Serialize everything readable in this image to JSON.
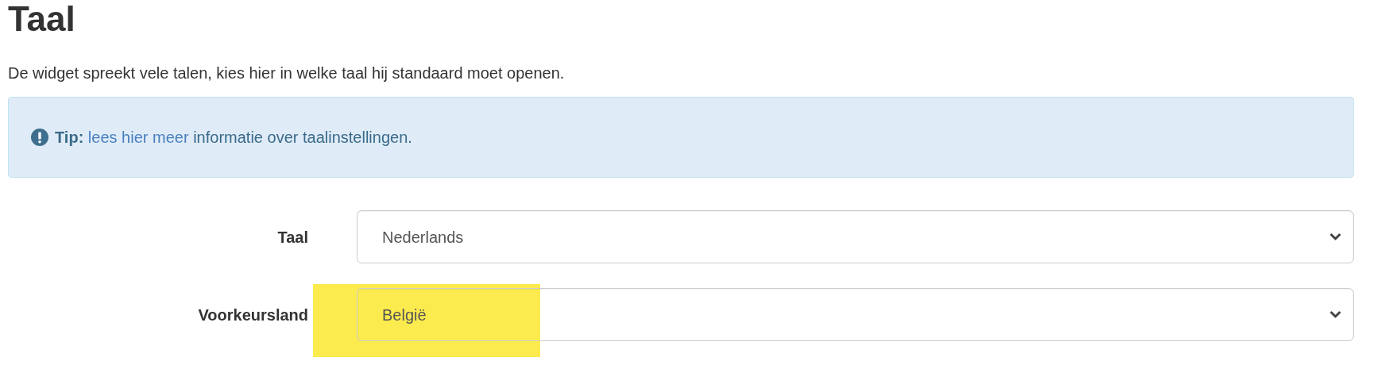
{
  "heading": "Taal",
  "description": "De widget spreekt vele talen, kies hier in welke taal hij standaard moet openen.",
  "alert": {
    "label": "Tip:",
    "link": "lees hier meer",
    "text": "informatie over taalinstellingen."
  },
  "fields": [
    {
      "label": "Taal",
      "value": "Nederlands",
      "highlighted": false
    },
    {
      "label": "Voorkeursland",
      "value": "België",
      "highlighted": true
    }
  ]
}
